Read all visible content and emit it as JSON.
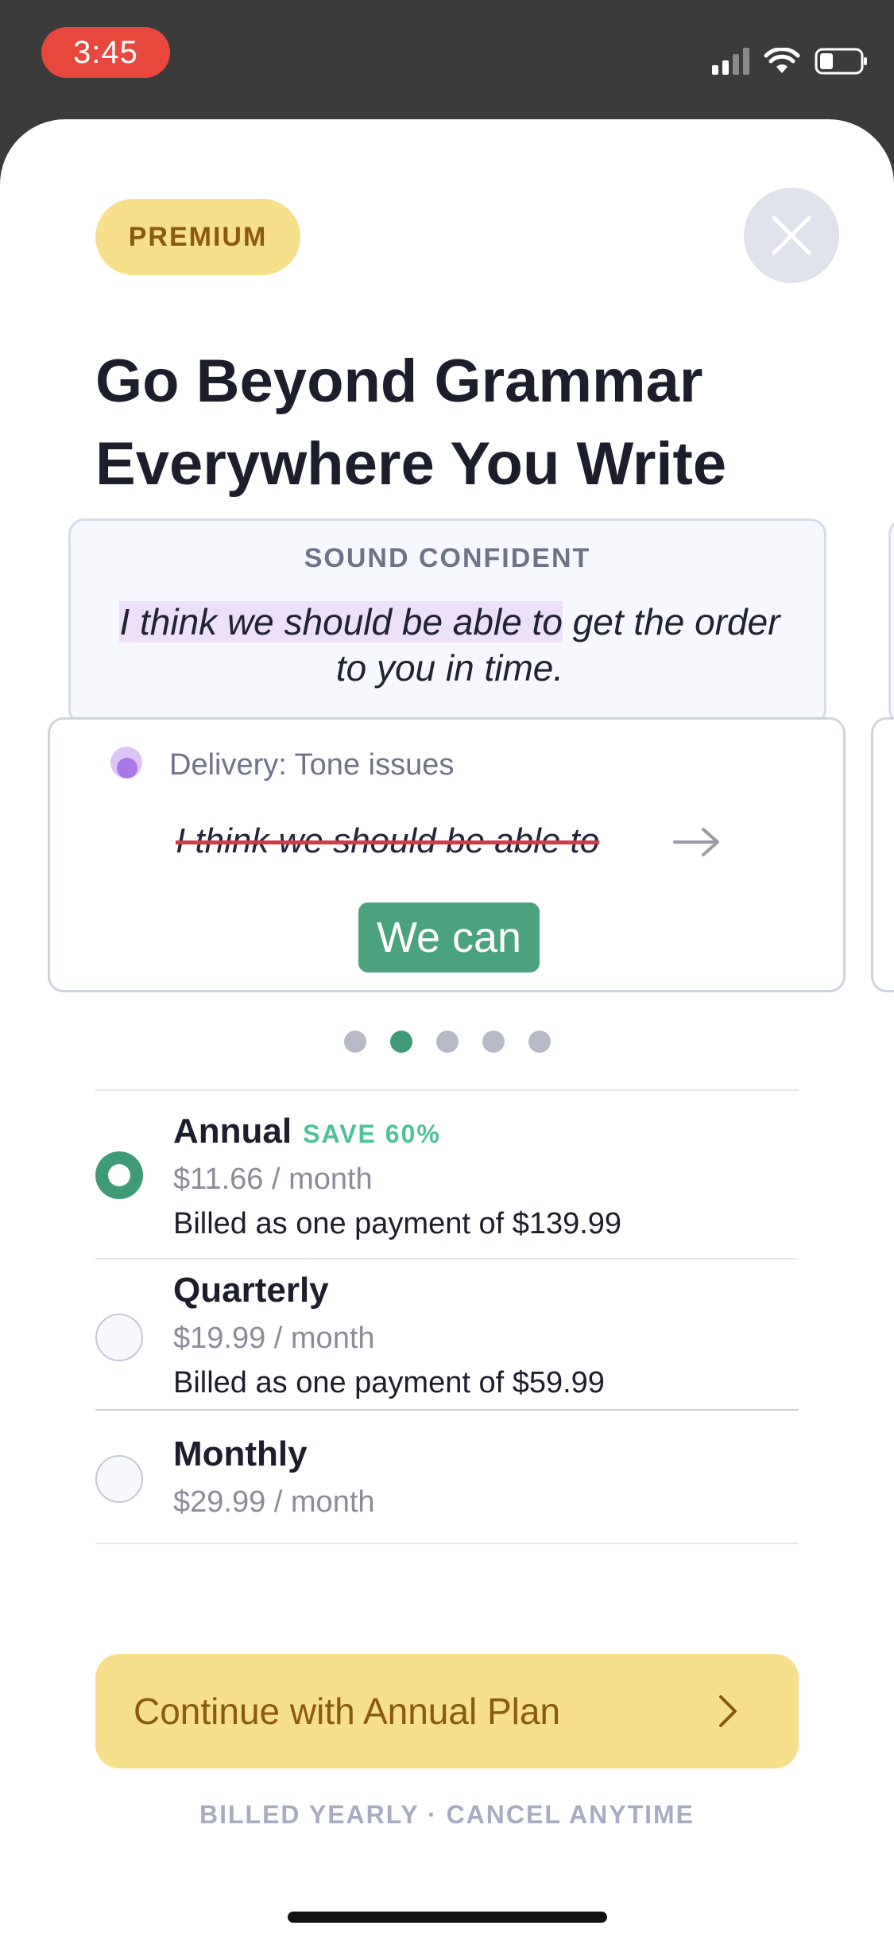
{
  "status_bar": {
    "time": "3:45"
  },
  "badge": {
    "label": "PREMIUM"
  },
  "headline": {
    "line1": "Go Beyond Grammar",
    "line2": "Everywhere You Write"
  },
  "example": {
    "label": "SOUND CONFIDENT",
    "highlighted": "I think we should be able to",
    "rest": " get the order to you in time."
  },
  "suggestion": {
    "category": "Delivery: Tone issues",
    "original": "I think we should be able to",
    "replacement": "We can"
  },
  "carousel": {
    "total": 5,
    "active_index": 1
  },
  "plans": [
    {
      "name": "Annual",
      "badge": "SAVE 60%",
      "price": "$11.66 / month",
      "billed": "Billed as one payment of $139.99",
      "selected": true
    },
    {
      "name": "Quarterly",
      "price": "$19.99 / month",
      "billed": "Billed as one payment of $59.99",
      "selected": false
    },
    {
      "name": "Monthly",
      "price": "$29.99 / month",
      "selected": false
    }
  ],
  "cta": {
    "label": "Continue with Annual Plan"
  },
  "footnote": "BILLED YEARLY · CANCEL ANYTIME",
  "colors": {
    "accent_green": "#3f9a78",
    "premium_yellow": "#f7df8c",
    "premium_text": "#8a5a10",
    "strike_red": "#d23a44"
  }
}
